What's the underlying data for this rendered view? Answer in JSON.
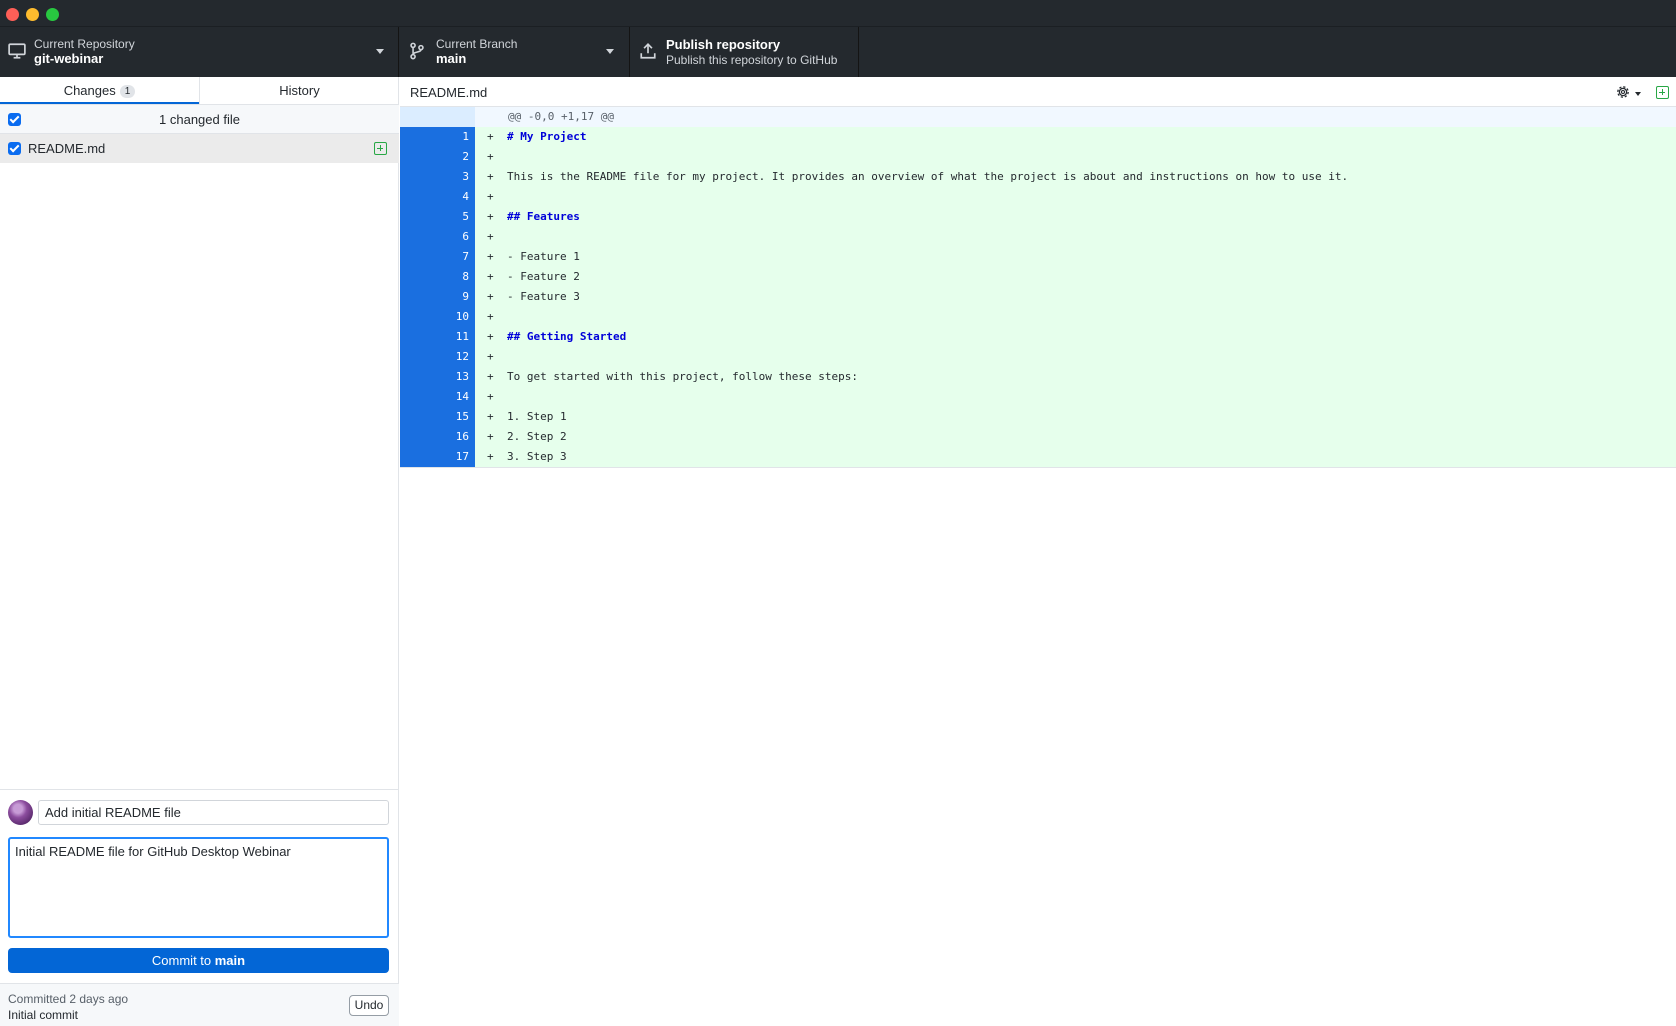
{
  "toolbar": {
    "repository": {
      "label": "Current Repository",
      "value": "git-webinar"
    },
    "branch": {
      "label": "Current Branch",
      "value": "main"
    },
    "publish": {
      "label": "Publish repository",
      "description": "Publish this repository to GitHub"
    }
  },
  "sidebar": {
    "tabs": [
      {
        "label": "Changes",
        "count": "1"
      },
      {
        "label": "History"
      }
    ],
    "changed_files_header": "1 changed file",
    "files": [
      {
        "name": "README.md",
        "status": "added"
      }
    ]
  },
  "commit": {
    "summary": "Add initial README file",
    "description": "Initial README file for GitHub Desktop Webinar",
    "button_prefix": "Commit to ",
    "button_branch": "main"
  },
  "last_commit": {
    "time": "Committed 2 days ago",
    "message": "Initial commit",
    "undo_label": "Undo"
  },
  "diff": {
    "file_name": "README.md",
    "hunk_header": "@@ -0,0 +1,17 @@",
    "lines": [
      {
        "num": "1",
        "sign": "+",
        "text": "# My Project",
        "heading": true
      },
      {
        "num": "2",
        "sign": "+",
        "text": "",
        "heading": false
      },
      {
        "num": "3",
        "sign": "+",
        "text": "This is the README file for my project. It provides an overview of what the project is about and instructions on how to use it.",
        "heading": false
      },
      {
        "num": "4",
        "sign": "+",
        "text": "",
        "heading": false
      },
      {
        "num": "5",
        "sign": "+",
        "text": "## Features",
        "heading": true
      },
      {
        "num": "6",
        "sign": "+",
        "text": "",
        "heading": false
      },
      {
        "num": "7",
        "sign": "+",
        "text": "- Feature 1",
        "heading": false
      },
      {
        "num": "8",
        "sign": "+",
        "text": "- Feature 2",
        "heading": false
      },
      {
        "num": "9",
        "sign": "+",
        "text": "- Feature 3",
        "heading": false
      },
      {
        "num": "10",
        "sign": "+",
        "text": "",
        "heading": false
      },
      {
        "num": "11",
        "sign": "+",
        "text": "## Getting Started",
        "heading": true
      },
      {
        "num": "12",
        "sign": "+",
        "text": "",
        "heading": false
      },
      {
        "num": "13",
        "sign": "+",
        "text": "To get started with this project, follow these steps:",
        "heading": false
      },
      {
        "num": "14",
        "sign": "+",
        "text": "",
        "heading": false
      },
      {
        "num": "15",
        "sign": "+",
        "text": "1. Step 1",
        "heading": false
      },
      {
        "num": "16",
        "sign": "+",
        "text": "2. Step 2",
        "heading": false
      },
      {
        "num": "17",
        "sign": "+",
        "text": "3. Step 3",
        "heading": false
      }
    ]
  },
  "icons": {
    "repository": "desktop-computer-icon",
    "branch": "git-branch-icon",
    "publish": "upload-icon",
    "settings": "gear-icon",
    "file_status": "file-added-icon"
  },
  "colors": {
    "toolbar_bg": "#24292e",
    "accent": "#0366d6",
    "added_line_bg": "#e6ffec",
    "line_gutter": "#1a6fe0",
    "added_icon": "#28a745"
  }
}
